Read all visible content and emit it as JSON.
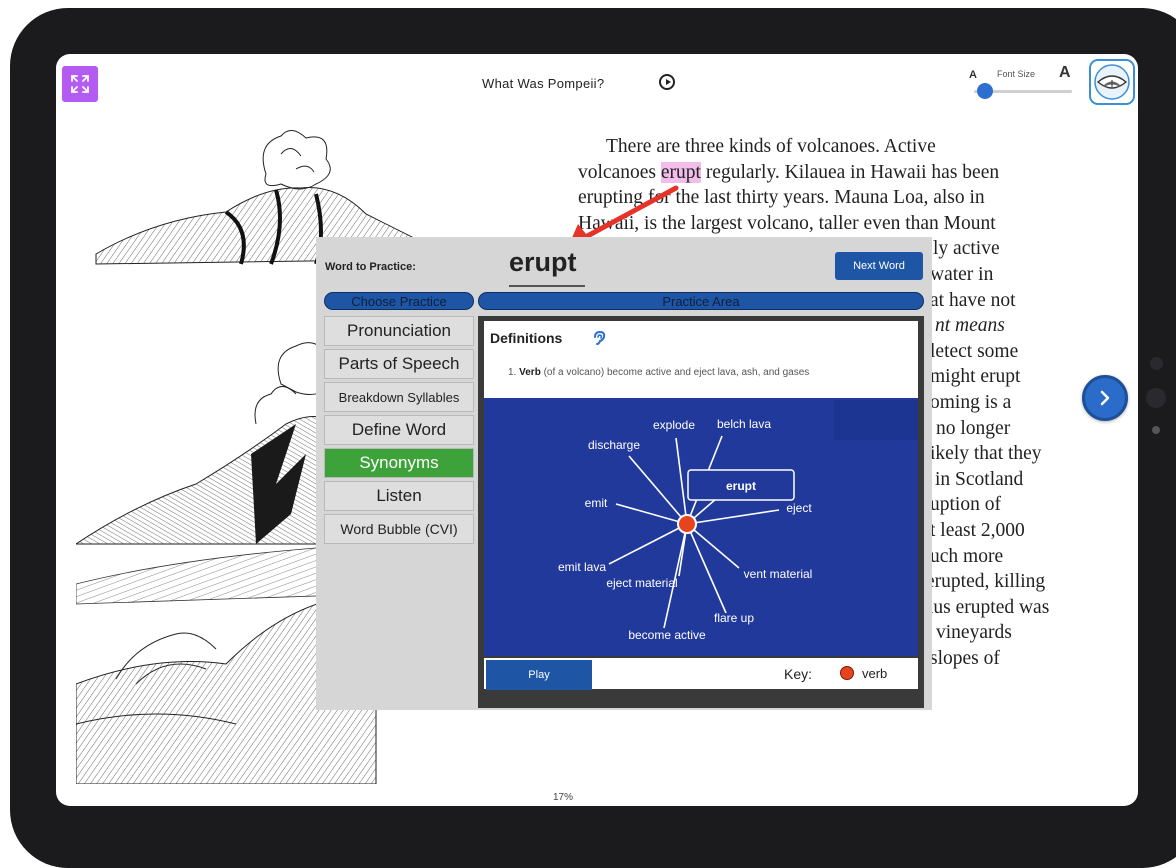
{
  "book": {
    "title": "What Was Pompeii?",
    "progress": "17%",
    "progress_fraction": 0.17
  },
  "font_size": {
    "small_a": "A",
    "big_a": "A",
    "label": "Font Size",
    "level": 0.05
  },
  "icons": {
    "expand": "expand-arrows-icon",
    "play": "play-circle-icon",
    "logo": "reading-eye-logo",
    "ear": "ear-listen-icon",
    "next_page": "chevron-right-icon"
  },
  "colors": {
    "accent_purple": "#b45cf2",
    "primary_blue": "#1e56a5",
    "graph_blue": "#21399b",
    "highlight_pink": "#f2bde8",
    "active_green": "#3ea23a",
    "verb_red": "#e8431f"
  },
  "page_text": {
    "lines": [
      "There are three kinds of volcanoes. Active",
      "volcanoes ",
      "regularly. Kilauea in Hawaii has been",
      "erupting for the last thirty years. Mauna Loa, also in",
      "Hawaii, is the largest volcano, taller even than Mount",
      "ly active",
      "water in",
      "at have not",
      "nt means",
      "letect some",
      "might erupt",
      "oming is a",
      "no longer",
      "ikely that they",
      "in Scotland",
      "uption of",
      "t least 2,000",
      "uch more",
      "erupted, killing",
      "ius erupted was",
      "vineyards",
      "slopes of"
    ],
    "highlighted_word": "erupt"
  },
  "practice": {
    "word_label": "Word to Practice:",
    "word": "erupt",
    "next_word": "Next Word",
    "choose_label": "Choose Practice",
    "area_label": "Practice Area",
    "menu": [
      "Pronunciation",
      "Parts of Speech",
      "Breakdown Syllables",
      "Define Word",
      "Synonyms",
      "Listen",
      "Word Bubble (CVI)"
    ],
    "active_item": "Synonyms",
    "definitions_title": "Definitions",
    "definition": {
      "number": "1.",
      "pos": "Verb",
      "text": "(of a volcano) become active and eject lava, ash, and gases"
    },
    "synonyms_center": "erupt",
    "synonyms": [
      "explode",
      "belch lava",
      "discharge",
      "emit",
      "eject",
      "emit lava",
      "eject material",
      "vent material",
      "flare up",
      "become active"
    ],
    "play_label": "Play",
    "key_label": "Key:",
    "key_item": "verb"
  }
}
